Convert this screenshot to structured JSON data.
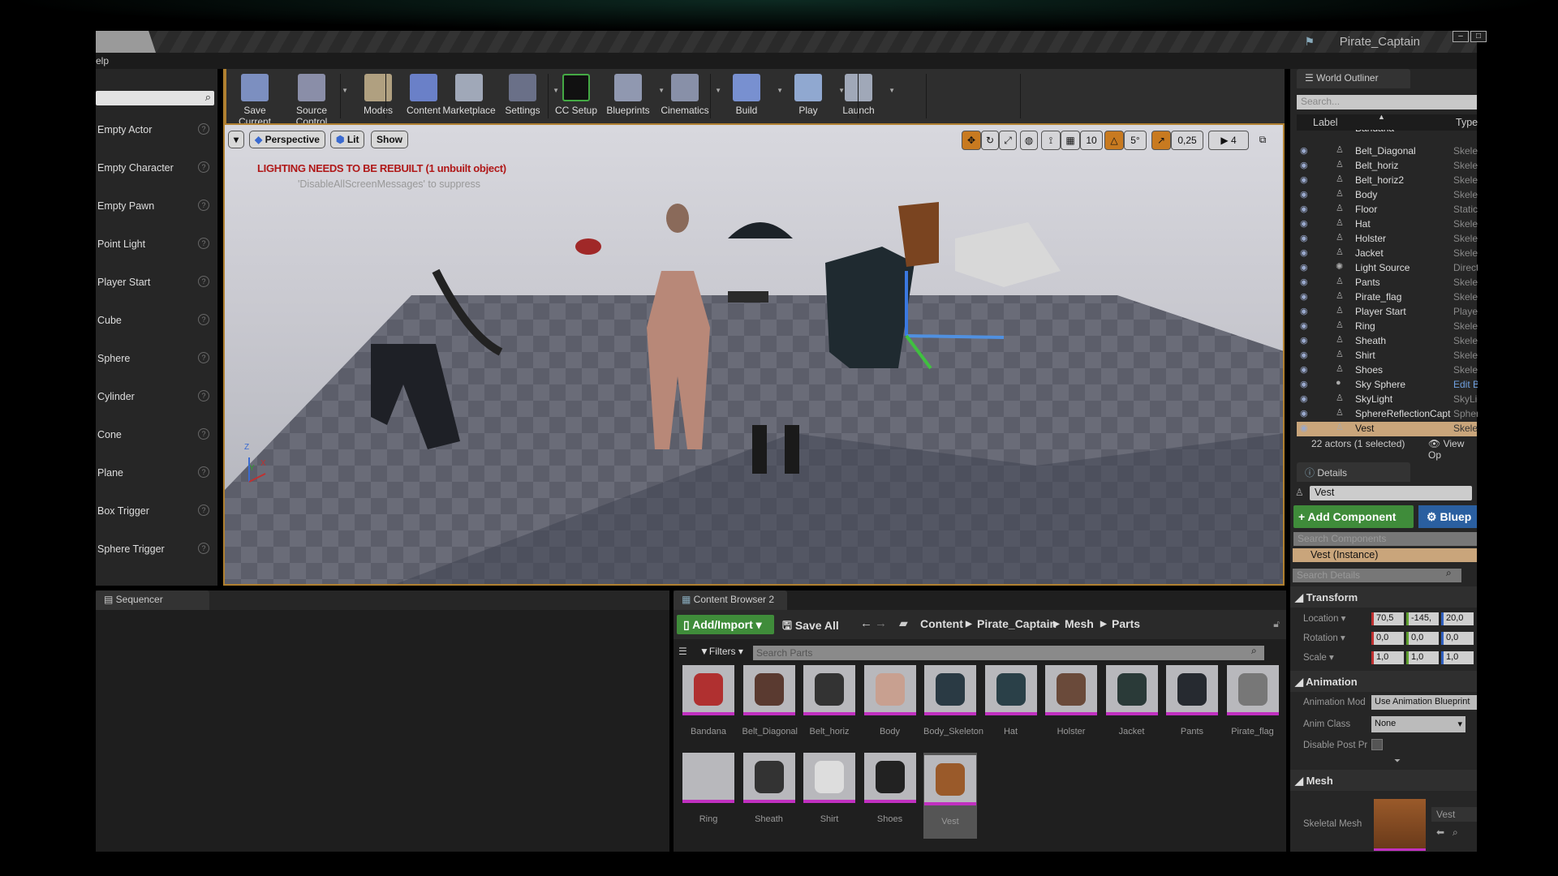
{
  "window": {
    "title": "Pirate_Captain",
    "menu_partial": "elp",
    "minimize": "–",
    "maximize": "□"
  },
  "place_panel": {
    "items": [
      "Empty Actor",
      "Empty Character",
      "Empty Pawn",
      "Point Light",
      "Player Start",
      "Cube",
      "Sphere",
      "Cylinder",
      "Cone",
      "Plane",
      "Box Trigger",
      "Sphere Trigger"
    ],
    "help": "?"
  },
  "toolbar": [
    {
      "label": "Save Current",
      "color": "#7c8fc0"
    },
    {
      "label": "Source Control",
      "color": "#8a8ea8",
      "dd": true
    },
    {
      "label": "Modes",
      "color": "#b0a080",
      "dd": true
    },
    {
      "label": "Content",
      "color": "#6a80c8"
    },
    {
      "label": "Marketplace",
      "color": "#a0a8b8"
    },
    {
      "label": "Settings",
      "color": "#6a7088",
      "dd": true
    },
    {
      "label": "CC Setup",
      "color": "#111"
    },
    {
      "label": "Blueprints",
      "color": "#9098b0",
      "dd": true
    },
    {
      "label": "Cinematics",
      "color": "#8890a8",
      "dd": true
    },
    {
      "label": "Build",
      "color": "#7890d0",
      "dd": true
    },
    {
      "label": "Play",
      "color": "#90a8d0",
      "dd": true
    },
    {
      "label": "Launch",
      "color": "#a0a8b8",
      "dd": true
    }
  ],
  "viewport": {
    "perspective": "Perspective",
    "lit": "Lit",
    "show": "Show",
    "warning": "LIGHTING NEEDS TO BE REBUILT (1 unbuilt object)",
    "suppress": "'DisableAllScreenMessages' to suppress",
    "grid_snap": "10",
    "rot_snap": "5°",
    "scale_snap": "0,25",
    "cam_speed": "4",
    "axis_z": "Z",
    "axis_y": "Y",
    "axis_x": "X"
  },
  "sequencer": {
    "tab": "Sequencer"
  },
  "content_browser": {
    "tab": "Content Browser 2",
    "add_import": "Add/Import",
    "save_all": "Save All",
    "breadcrumb": [
      "Content",
      "Pirate_Captain",
      "Mesh",
      "Parts"
    ],
    "filters": "Filters",
    "search_placeholder": "Search Parts",
    "assets": [
      {
        "name": "Bandana",
        "color": "#b03030"
      },
      {
        "name": "Belt_Diagonal",
        "color": "#5a3a30"
      },
      {
        "name": "Belt_horiz",
        "color": "#333"
      },
      {
        "name": "Body",
        "color": "#c8a090"
      },
      {
        "name": "Body_Skeleton",
        "color": "#2a3a44"
      },
      {
        "name": "Hat",
        "color": "#2a4048"
      },
      {
        "name": "Holster",
        "color": "#6a4a3a"
      },
      {
        "name": "Jacket",
        "color": "#2a3a38"
      },
      {
        "name": "Pants",
        "color": "#262a30"
      },
      {
        "name": "Pirate_flag",
        "color": "#777"
      },
      {
        "name": "Ring",
        "color": "#b8b8bc"
      },
      {
        "name": "Sheath",
        "color": "#333"
      },
      {
        "name": "Shirt",
        "color": "#ddd"
      },
      {
        "name": "Shoes",
        "color": "#222"
      },
      {
        "name": "Vest",
        "color": "#9a5a2a"
      }
    ]
  },
  "outliner": {
    "tab": "World Outliner",
    "search_placeholder": "Search...",
    "col_label": "Label",
    "col_type": "Type",
    "rows": [
      {
        "label": "Bandana",
        "type": "Skeleta"
      },
      {
        "label": "Belt_Diagonal",
        "type": "Skeleta"
      },
      {
        "label": "Belt_horiz",
        "type": "Skeleta"
      },
      {
        "label": "Belt_horiz2",
        "type": "Skeleta"
      },
      {
        "label": "Body",
        "type": "Skeleta"
      },
      {
        "label": "Floor",
        "type": "StaticM"
      },
      {
        "label": "Hat",
        "type": "Skeleta"
      },
      {
        "label": "Holster",
        "type": "Skeleta"
      },
      {
        "label": "Jacket",
        "type": "Skeleta"
      },
      {
        "label": "Light Source",
        "type": "Directio"
      },
      {
        "label": "Pants",
        "type": "Skeleta"
      },
      {
        "label": "Pirate_flag",
        "type": "Skeleta"
      },
      {
        "label": "Player Start",
        "type": "PlayerS"
      },
      {
        "label": "Ring",
        "type": "Skeleta"
      },
      {
        "label": "Sheath",
        "type": "Skeleta"
      },
      {
        "label": "Shirt",
        "type": "Skeleta"
      },
      {
        "label": "Shoes",
        "type": "Skeleta"
      },
      {
        "label": "Sky Sphere",
        "type": "Edit BP"
      },
      {
        "label": "SkyLight",
        "type": "SkyLigh"
      },
      {
        "label": "SphereReflectionCapt",
        "type": "Sphere"
      },
      {
        "label": "Vest",
        "type": "Skeleta"
      }
    ],
    "status": "22 actors (1 selected)",
    "view_options": "View Op"
  },
  "details": {
    "tab": "Details",
    "name": "Vest",
    "add_component": "+ Add Component",
    "blueprint": "Bluep",
    "search_components": "Search Components",
    "instance": "Vest (Instance)",
    "search_details": "Search Details",
    "transform": "Transform",
    "location_label": "Location",
    "rotation_label": "Rotation",
    "scale_label": "Scale",
    "location": [
      "70,5",
      "-145,",
      "20,0"
    ],
    "rotation": [
      "0,0",
      "0,0",
      "0,0"
    ],
    "scale": [
      "1,0",
      "1,0",
      "1,0"
    ],
    "animation": "Animation",
    "anim_mode_label": "Animation Mod",
    "anim_mode": "Use Animation Blueprint",
    "anim_class_label": "Anim Class",
    "anim_class": "None",
    "disable_post_label": "Disable Post Pr",
    "mesh": "Mesh",
    "skeletal_mesh_label": "Skeletal Mesh",
    "skeletal_mesh": "Vest"
  }
}
